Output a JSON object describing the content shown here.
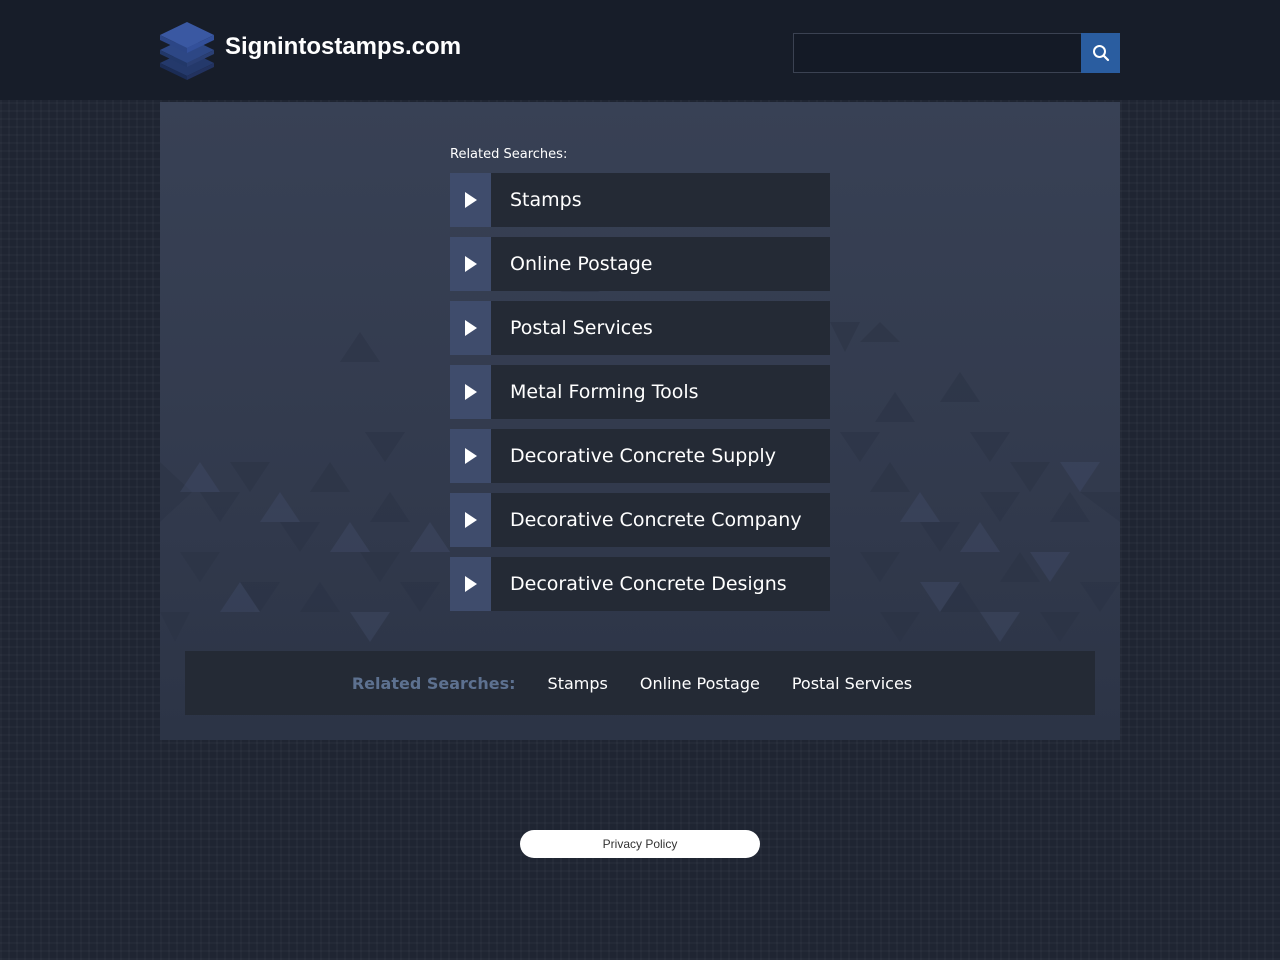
{
  "header": {
    "site_name": "Signintostamps.com",
    "search": {
      "placeholder": "",
      "value": ""
    }
  },
  "related": {
    "heading": "Related Searches:",
    "items": [
      {
        "label": "Stamps"
      },
      {
        "label": "Online Postage"
      },
      {
        "label": "Postal Services"
      },
      {
        "label": "Metal Forming Tools"
      },
      {
        "label": "Decorative Concrete Supply"
      },
      {
        "label": "Decorative Concrete Company"
      },
      {
        "label": "Decorative Concrete Designs"
      }
    ]
  },
  "bottom_bar": {
    "heading": "Related Searches:",
    "links": [
      {
        "label": "Stamps"
      },
      {
        "label": "Online Postage"
      },
      {
        "label": "Postal Services"
      }
    ]
  },
  "footer": {
    "privacy_label": "Privacy Policy"
  },
  "colors": {
    "page_bg": "#1f2532",
    "header_bg": "#171d29",
    "panel_bg": "#384155",
    "link_bg": "#242a35",
    "arrow_bg": "#3f4c6c",
    "search_button": "#2a5da0",
    "bottom_heading": "#5d7190"
  },
  "icons": {
    "logo": "stacked-layers-icon",
    "search": "magnifier-icon",
    "arrow": "play-triangle-icon"
  }
}
